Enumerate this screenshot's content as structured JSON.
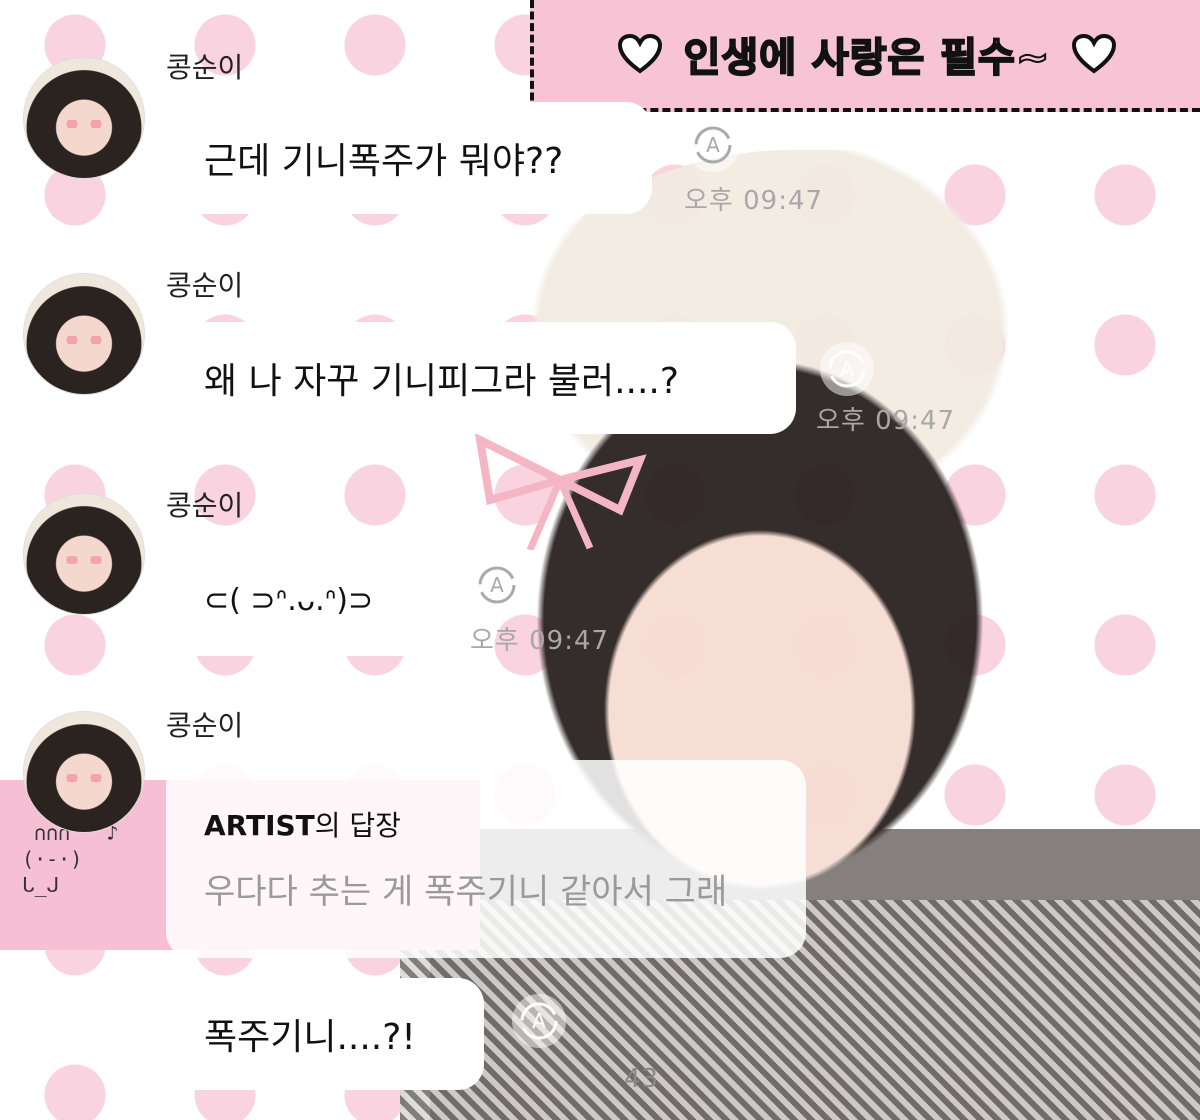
{
  "banner": {
    "text": "인생에 사랑은 필수~"
  },
  "messages": [
    {
      "sender": "콩순이",
      "text": "근데 기니폭주가 뭐야??",
      "time": "오후 09:47"
    },
    {
      "sender": "콩순이",
      "text": "왜 나 자꾸 기니피그라 불러....?",
      "time": "오후 09:47"
    },
    {
      "sender": "콩순이",
      "text": "⊂(  ⊃ᐢ.ᴗ.ᐢ)⊃",
      "time": "오후 09:47"
    },
    {
      "sender": "콩순이",
      "reply_label_bold": "ARTIST",
      "reply_label_suffix": "의 답장",
      "reply_text": "우다다 추는 게 폭주기니 같아서 그래"
    }
  ],
  "last_message": {
    "text": "폭주기니....?!",
    "time": "43"
  },
  "colors": {
    "pink": "#f6c4d4",
    "polka": "#f9d3e0"
  },
  "icons": [
    "heart-icon",
    "read-status-icon",
    "avatar"
  ]
}
